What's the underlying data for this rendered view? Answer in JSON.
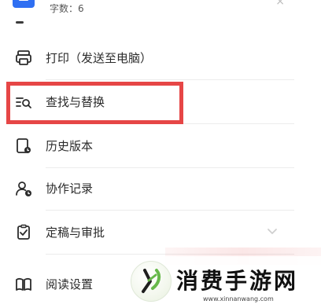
{
  "header": {
    "word_count": "字数：6"
  },
  "menu": {
    "items": [
      {
        "label": "打印（发送至电脑）",
        "icon": "printer-icon"
      },
      {
        "label": "查找与替换",
        "icon": "find-replace-icon"
      },
      {
        "label": "历史版本",
        "icon": "history-icon"
      },
      {
        "label": "协作记录",
        "icon": "collaboration-record-icon"
      },
      {
        "label": "定稿与审批",
        "icon": "approval-icon"
      },
      {
        "label": "阅读设置",
        "icon": "book-icon"
      }
    ]
  },
  "watermark": {
    "title": "消费手游网",
    "url": "www.xinnanwang.com"
  },
  "colors": {
    "highlight": "#e64646",
    "brand_blue": "#2f6ff2"
  }
}
